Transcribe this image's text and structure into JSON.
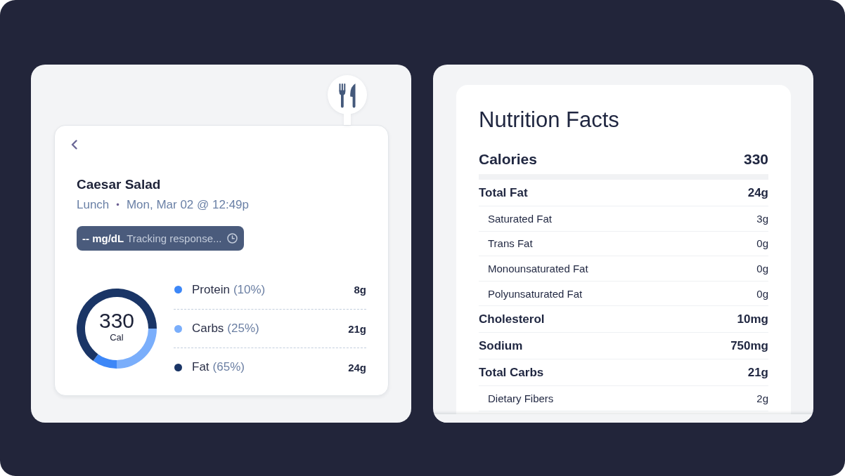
{
  "meal_panel": {
    "meal": {
      "title": "Caesar Salad",
      "meal_type": "Lunch",
      "separator": "•",
      "datetime": "Mon, Mar 02 @ 12:49p"
    },
    "glucose_badge": {
      "reading": "-- mg/dL",
      "status": "Tracking response..."
    },
    "calories": {
      "value": "330",
      "unit": "Cal"
    },
    "chart_data": {
      "type": "donut",
      "values": [
        10,
        25,
        65
      ]
    },
    "macros": [
      {
        "name": "Protein",
        "share": "(10%)",
        "amount": "8g",
        "color": "#3d87f7"
      },
      {
        "name": "Carbs",
        "share": "(25%)",
        "amount": "21g",
        "color": "#7aaefb"
      },
      {
        "name": "Fat",
        "share": "(65%)",
        "amount": "24g",
        "color": "#1a3566"
      }
    ]
  },
  "nutrition_panel": {
    "title": "Nutrition Facts",
    "rows": [
      {
        "kind": "calories",
        "label": "Calories",
        "value": "330"
      },
      {
        "kind": "main",
        "label": "Total Fat",
        "value": "24g"
      },
      {
        "kind": "sub",
        "label": "Saturated Fat",
        "value": "3g"
      },
      {
        "kind": "sub",
        "label": "Trans Fat",
        "value": "0g"
      },
      {
        "kind": "sub",
        "label": "Monounsaturated Fat",
        "value": "0g"
      },
      {
        "kind": "sub",
        "label": "Polyunsaturated Fat",
        "value": "0g"
      },
      {
        "kind": "main",
        "label": "Cholesterol",
        "value": "10mg"
      },
      {
        "kind": "main",
        "label": "Sodium",
        "value": "750mg"
      },
      {
        "kind": "main",
        "label": "Total Carbs",
        "value": "21g"
      },
      {
        "kind": "sub",
        "label": "Dietary Fibers",
        "value": "2g"
      }
    ]
  }
}
